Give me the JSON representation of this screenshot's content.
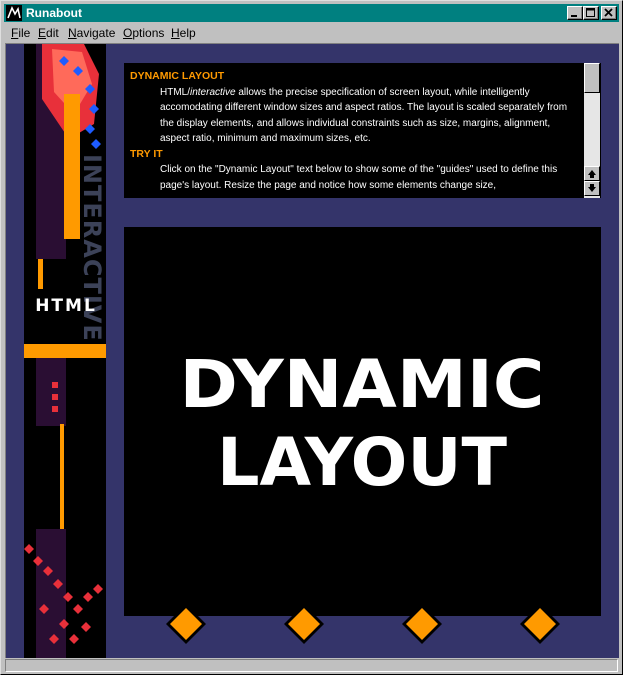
{
  "window": {
    "title": "Runabout",
    "icon": "runabout-app-icon",
    "controls": [
      "minimize-icon",
      "maximize-icon",
      "close-icon"
    ]
  },
  "menu": [
    {
      "label": "File",
      "underline": "F",
      "rest": "ile"
    },
    {
      "label": "Edit",
      "underline": "E",
      "rest": "dit"
    },
    {
      "label": "Navigate",
      "underline": "N",
      "rest": "avigate"
    },
    {
      "label": "Options",
      "underline": "O",
      "rest": "ptions"
    },
    {
      "label": "Help",
      "underline": "H",
      "rest": "elp"
    }
  ],
  "banner": {
    "vertical_text": "INTERACTIVE",
    "logo_text": "HTML"
  },
  "info_panel": {
    "heading1": "DYNAMIC LAYOUT",
    "para1_prefix": "HTML/",
    "para1_italic": "interactive",
    "para1_rest": " allows the precise specification of screen layout, while intelligently accomodating different window sizes and aspect ratios. The layout is scaled separately from the display elements, and allows individual constraints such as size, margins, alignment, aspect ratio, minimum and maximum sizes, etc.",
    "heading2": "TRY IT",
    "para2": "Click on the \"Dynamic Layout\" text below to show some of the \"guides\" used to define this page's layout. Resize the page and notice how some elements change size,"
  },
  "display": {
    "line1": "DYNAMIC",
    "line2": "LAYOUT"
  },
  "colors": {
    "background": "#34346a",
    "accent_orange": "#ff9a00",
    "titlebar": "#008080"
  },
  "nav_buttons": [
    "diamond-button-1",
    "diamond-button-2",
    "diamond-button-3",
    "diamond-button-4"
  ]
}
